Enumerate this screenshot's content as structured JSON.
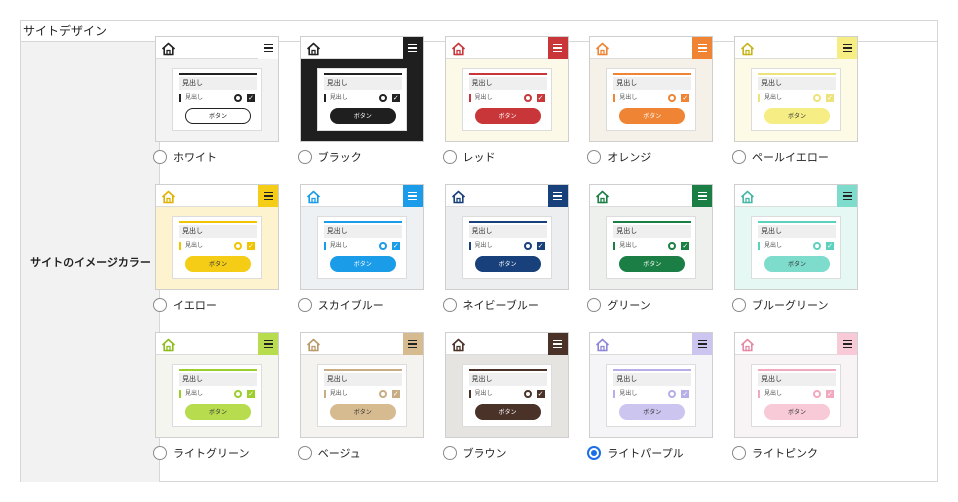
{
  "section_title": "サイトデザイン",
  "field_label": "サイトのイメージカラー",
  "preview_text": {
    "heading": "見出し",
    "subheading": "見出し",
    "button": "ボタン"
  },
  "selected": "lightpurple",
  "themes": [
    {
      "id": "white",
      "label": "ホワイト",
      "accent": "#222222",
      "bg": "#f3f3f3",
      "menu_bg": "#ffffff",
      "menu_fg": "#222222",
      "btn_bg": "#ffffff",
      "btn_fg": "#222222",
      "btn_border": "#222222",
      "home": "#222222"
    },
    {
      "id": "black",
      "label": "ブラック",
      "accent": "#222222",
      "bg": "#1f1f1f",
      "menu_bg": "#1f1f1f",
      "menu_fg": "#ffffff",
      "btn_bg": "#1f1f1f",
      "btn_fg": "#ffffff",
      "btn_border": "#1f1f1f",
      "home": "#222222"
    },
    {
      "id": "red",
      "label": "レッド",
      "accent": "#c8363a",
      "bg": "#fdf9e9",
      "menu_bg": "#c8363a",
      "menu_fg": "#ffffff",
      "btn_bg": "#c8363a",
      "btn_fg": "#ffffff",
      "btn_border": "#c8363a",
      "home": "#c8363a"
    },
    {
      "id": "orange",
      "label": "オレンジ",
      "accent": "#ee8434",
      "bg": "#f5f1e9",
      "menu_bg": "#ee8434",
      "menu_fg": "#ffffff",
      "btn_bg": "#ee8434",
      "btn_fg": "#ffffff",
      "btn_border": "#ee8434",
      "home": "#ee8434"
    },
    {
      "id": "paleyellow",
      "label": "ペールイエロー",
      "accent": "#ece47a",
      "bg": "#fdfae6",
      "menu_bg": "#f6ed85",
      "menu_fg": "#222222",
      "btn_bg": "#f6ed85",
      "btn_fg": "#333333",
      "btn_border": "#f6ed85",
      "home": "#c8b51e"
    },
    {
      "id": "yellow",
      "label": "イエロー",
      "accent": "#f1c400",
      "bg": "#fdf3cf",
      "menu_bg": "#f5cd17",
      "menu_fg": "#222222",
      "btn_bg": "#f5cd17",
      "btn_fg": "#333333",
      "btn_border": "#f5cd17",
      "home": "#e0b200"
    },
    {
      "id": "skyblue",
      "label": "スカイブルー",
      "accent": "#1a9ce8",
      "bg": "#eef1f4",
      "menu_bg": "#1a9ce8",
      "menu_fg": "#ffffff",
      "btn_bg": "#1a9ce8",
      "btn_fg": "#ffffff",
      "btn_border": "#1a9ce8",
      "home": "#1a9ce8"
    },
    {
      "id": "navyblue",
      "label": "ネイビーブルー",
      "accent": "#18407a",
      "bg": "#eceef0",
      "menu_bg": "#18407a",
      "menu_fg": "#ffffff",
      "btn_bg": "#18407a",
      "btn_fg": "#ffffff",
      "btn_border": "#18407a",
      "home": "#18407a"
    },
    {
      "id": "green",
      "label": "グリーン",
      "accent": "#1b7f45",
      "bg": "#eef0ee",
      "menu_bg": "#1b7f45",
      "menu_fg": "#ffffff",
      "btn_bg": "#1b7f45",
      "btn_fg": "#ffffff",
      "btn_border": "#1b7f45",
      "home": "#1b7f45"
    },
    {
      "id": "bluegreen",
      "label": "ブルーグリーン",
      "accent": "#5cd1bd",
      "bg": "#e6f8f4",
      "menu_bg": "#7ddccb",
      "menu_fg": "#222222",
      "btn_bg": "#7ddccb",
      "btn_fg": "#333333",
      "btn_border": "#7ddccb",
      "home": "#46b8a5"
    },
    {
      "id": "lightgreen",
      "label": "ライトグリーン",
      "accent": "#9ccf2c",
      "bg": "#f4f5ee",
      "menu_bg": "#b7dd4f",
      "menu_fg": "#222222",
      "btn_bg": "#b7dd4f",
      "btn_fg": "#333333",
      "btn_border": "#b7dd4f",
      "home": "#8bbd1c"
    },
    {
      "id": "beige",
      "label": "ベージュ",
      "accent": "#c8ad84",
      "bg": "#f5f3ef",
      "menu_bg": "#d6bb91",
      "menu_fg": "#222222",
      "btn_bg": "#d6bb91",
      "btn_fg": "#333333",
      "btn_border": "#d6bb91",
      "home": "#b99a6a"
    },
    {
      "id": "brown",
      "label": "ブラウン",
      "accent": "#4a3228",
      "bg": "#e5e4e1",
      "menu_bg": "#4a3228",
      "menu_fg": "#ffffff",
      "btn_bg": "#4a3228",
      "btn_fg": "#ffffff",
      "btn_border": "#4a3228",
      "home": "#4a3228"
    },
    {
      "id": "lightpurple",
      "label": "ライトパープル",
      "accent": "#b5aee8",
      "bg": "#f5f5f8",
      "menu_bg": "#cbc5f0",
      "menu_fg": "#222222",
      "btn_bg": "#cbc5f0",
      "btn_fg": "#333333",
      "btn_border": "#cbc5f0",
      "home": "#8e86d6"
    },
    {
      "id": "lightpink",
      "label": "ライトピンク",
      "accent": "#f2a9bd",
      "bg": "#f8f4f5",
      "menu_bg": "#f8c9d6",
      "menu_fg": "#222222",
      "btn_bg": "#f8c9d6",
      "btn_fg": "#333333",
      "btn_border": "#f8c9d6",
      "home": "#e58aa3"
    }
  ]
}
